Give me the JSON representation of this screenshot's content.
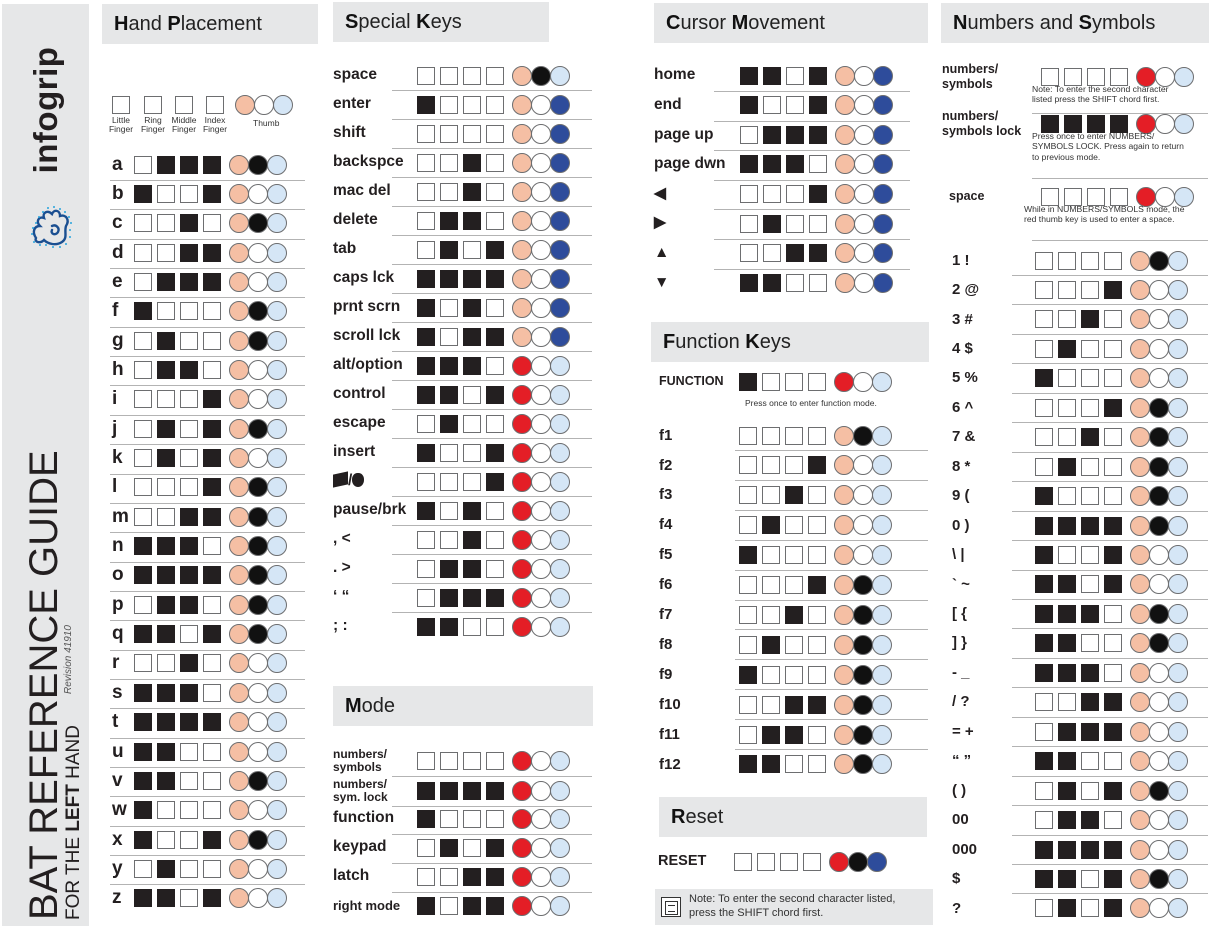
{
  "sidebar": {
    "brand": "infogrip",
    "title": "BAT REFERENCE GUIDE",
    "subtitle_prefix": "FOR THE ",
    "subtitle_bold": "LEFT",
    "subtitle_suffix": " HAND",
    "revision": "Revision 41910",
    "logo_icon": "hand-logo-icon"
  },
  "legend_encoding": {
    "fingers": "1 = key pressed (black square), 0 = not pressed",
    "thumbs": "p=peach, r=red, w=white, b=black, l=light-blue, u=dark-blue"
  },
  "colors": {
    "peach": "#f5bfa4",
    "red": "#e41e26",
    "black": "#111111",
    "light_blue": "#d5e6f6",
    "dark_blue": "#2e4c9b",
    "header_bg": "#e6e7e8"
  },
  "hand_placement": {
    "header_bold": "H",
    "header_rest": "and ",
    "header_bold2": "P",
    "header_rest2": "lacement",
    "legend": {
      "fingers": [
        "Little\nFinger",
        "Ring\nFinger",
        "Middle\nFinger",
        "Index\nFinger"
      ],
      "thumb": "Thumb"
    },
    "rows": [
      {
        "label": "a",
        "fingers": "0111",
        "thumbs": "pbl"
      },
      {
        "label": "b",
        "fingers": "1001",
        "thumbs": "pwl"
      },
      {
        "label": "c",
        "fingers": "0010",
        "thumbs": "pbl"
      },
      {
        "label": "d",
        "fingers": "0011",
        "thumbs": "pwl"
      },
      {
        "label": "e",
        "fingers": "0111",
        "thumbs": "pwl"
      },
      {
        "label": "f",
        "fingers": "1000",
        "thumbs": "pbl"
      },
      {
        "label": "g",
        "fingers": "0100",
        "thumbs": "pbl"
      },
      {
        "label": "h",
        "fingers": "0110",
        "thumbs": "pwl"
      },
      {
        "label": "i",
        "fingers": "0001",
        "thumbs": "pwl"
      },
      {
        "label": "j",
        "fingers": "0101",
        "thumbs": "pbl"
      },
      {
        "label": "k",
        "fingers": "0101",
        "thumbs": "pwl"
      },
      {
        "label": "l",
        "fingers": "0001",
        "thumbs": "pbl"
      },
      {
        "label": "m",
        "fingers": "0011",
        "thumbs": "pbl"
      },
      {
        "label": "n",
        "fingers": "1110",
        "thumbs": "pbl"
      },
      {
        "label": "o",
        "fingers": "1111",
        "thumbs": "pbl"
      },
      {
        "label": "p",
        "fingers": "0110",
        "thumbs": "pbl"
      },
      {
        "label": "q",
        "fingers": "1101",
        "thumbs": "pbl"
      },
      {
        "label": "r",
        "fingers": "0010",
        "thumbs": "pwl"
      },
      {
        "label": "s",
        "fingers": "1110",
        "thumbs": "pwl"
      },
      {
        "label": "t",
        "fingers": "1111",
        "thumbs": "pwl"
      },
      {
        "label": "u",
        "fingers": "1100",
        "thumbs": "pwl"
      },
      {
        "label": "v",
        "fingers": "1100",
        "thumbs": "pbl"
      },
      {
        "label": "w",
        "fingers": "1000",
        "thumbs": "pwl"
      },
      {
        "label": "x",
        "fingers": "1001",
        "thumbs": "pbl"
      },
      {
        "label": "y",
        "fingers": "0100",
        "thumbs": "pwl"
      },
      {
        "label": "z",
        "fingers": "1101",
        "thumbs": "pwl"
      }
    ]
  },
  "special_keys": {
    "header_bold": "S",
    "header_rest": "pecial ",
    "header_bold2": "K",
    "header_rest2": "eys",
    "rows": [
      {
        "label": "space",
        "fingers": "0000",
        "thumbs": "pbl"
      },
      {
        "label": "enter",
        "fingers": "1000",
        "thumbs": "pwu"
      },
      {
        "label": "shift",
        "fingers": "0000",
        "thumbs": "pwu"
      },
      {
        "label": "backspce",
        "fingers": "0010",
        "thumbs": "pwu"
      },
      {
        "label": "mac del",
        "fingers": "0010",
        "thumbs": "pwu"
      },
      {
        "label": "delete",
        "fingers": "0110",
        "thumbs": "pwu"
      },
      {
        "label": "tab",
        "fingers": "0101",
        "thumbs": "pwu"
      },
      {
        "label": "caps lck",
        "fingers": "1111",
        "thumbs": "pwu"
      },
      {
        "label": "prnt scrn",
        "fingers": "1010",
        "thumbs": "pwu"
      },
      {
        "label": "scroll lck",
        "fingers": "1011",
        "thumbs": "pwu"
      },
      {
        "label": "alt/option",
        "fingers": "1110",
        "thumbs": "rwl"
      },
      {
        "label": "control",
        "fingers": "1101",
        "thumbs": "rwl"
      },
      {
        "label": "escape",
        "fingers": "0100",
        "thumbs": "rwl"
      },
      {
        "label": "insert",
        "fingers": "1001",
        "thumbs": "rwl"
      },
      {
        "label": "⊞/",
        "fingers": "0001",
        "thumbs": "rwl"
      },
      {
        "label": "pause/brk",
        "fingers": "1010",
        "thumbs": "rwl"
      },
      {
        "label": ",  <",
        "fingers": "0010",
        "thumbs": "rwl"
      },
      {
        "label": ".  >",
        "fingers": "0110",
        "thumbs": "rwl"
      },
      {
        "label": "‘  “",
        "fingers": "0111",
        "thumbs": "rwl"
      },
      {
        "label": ";  :",
        "fingers": "1100",
        "thumbs": "rwl"
      }
    ]
  },
  "mode": {
    "header_bold": "M",
    "header_rest": "ode",
    "rows": [
      {
        "label": "numbers/\nsymbols",
        "fingers": "0000",
        "thumbs": "rwl",
        "small": true
      },
      {
        "label": "numbers/\nsym. lock",
        "fingers": "1111",
        "thumbs": "rwl",
        "small": true
      },
      {
        "label": "function",
        "fingers": "1000",
        "thumbs": "rwl"
      },
      {
        "label": "keypad",
        "fingers": "0101",
        "thumbs": "rwl"
      },
      {
        "label": "latch",
        "fingers": "0011",
        "thumbs": "rwl"
      },
      {
        "label": "right mode",
        "fingers": "1011",
        "thumbs": "rwl",
        "medium": true
      }
    ]
  },
  "cursor_movement": {
    "header_bold": "C",
    "header_rest": "ursor ",
    "header_bold2": "M",
    "header_rest2": "ovement",
    "rows": [
      {
        "label": "home",
        "fingers": "1101",
        "thumbs": "pwu"
      },
      {
        "label": "end",
        "fingers": "1001",
        "thumbs": "pwu"
      },
      {
        "label": "page up",
        "fingers": "0111",
        "thumbs": "pwu"
      },
      {
        "label": "page dwn",
        "fingers": "1110",
        "thumbs": "pwu"
      },
      {
        "label": "◀",
        "fingers": "0001",
        "thumbs": "pwu"
      },
      {
        "label": "▶",
        "fingers": "0100",
        "thumbs": "pwu"
      },
      {
        "label": "▲",
        "fingers": "0011",
        "thumbs": "pwu"
      },
      {
        "label": "▼",
        "fingers": "1100",
        "thumbs": "pwu"
      }
    ]
  },
  "function_keys": {
    "header_bold": "F",
    "header_rest": "unction ",
    "header_bold2": "K",
    "header_rest2": "eys",
    "function_row": {
      "label": "FUNCTION",
      "fingers": "1000",
      "thumbs": "rwl",
      "note": "Press once to enter function mode."
    },
    "rows": [
      {
        "label": "f1",
        "fingers": "0000",
        "thumbs": "pbl"
      },
      {
        "label": "f2",
        "fingers": "0001",
        "thumbs": "pwl"
      },
      {
        "label": "f3",
        "fingers": "0010",
        "thumbs": "pwl"
      },
      {
        "label": "f4",
        "fingers": "0100",
        "thumbs": "pwl"
      },
      {
        "label": "f5",
        "fingers": "1000",
        "thumbs": "pwl"
      },
      {
        "label": "f6",
        "fingers": "0001",
        "thumbs": "pbl"
      },
      {
        "label": "f7",
        "fingers": "0010",
        "thumbs": "pbl"
      },
      {
        "label": "f8",
        "fingers": "0100",
        "thumbs": "pbl"
      },
      {
        "label": "f9",
        "fingers": "1000",
        "thumbs": "pbl"
      },
      {
        "label": "f10",
        "fingers": "0011",
        "thumbs": "pbl"
      },
      {
        "label": "f11",
        "fingers": "0110",
        "thumbs": "pbl"
      },
      {
        "label": "f12",
        "fingers": "1100",
        "thumbs": "pbl"
      }
    ]
  },
  "reset": {
    "header_bold": "R",
    "header_rest": "eset",
    "row": {
      "label": "RESET",
      "fingers": "0000",
      "thumbs": "rbu"
    },
    "note": "Note: To enter the second character listed,\npress the SHIFT chord first.",
    "note_icon": "note-icon"
  },
  "numbers_symbols": {
    "header_bold": "N",
    "header_rest": "umbers and ",
    "header_bold2": "S",
    "header_rest2": "ymbols",
    "mode_rows": [
      {
        "label": "numbers/\nsymbols",
        "fingers": "0000",
        "thumbs": "rwl",
        "note": "Note: To enter the second character\nlisted press the SHIFT chord first."
      },
      {
        "label": "numbers/\nsymbols lock",
        "fingers": "1111",
        "thumbs": "rwl",
        "note": "Press once to enter NUMBERS/\nSYMBOLS LOCK. Press again to return\n to previous mode."
      },
      {
        "label": "space",
        "fingers": "0000",
        "thumbs": "rwl",
        "note": "While in NUMBERS/SYMBOLS mode, the\nred thumb key is used to enter a space."
      }
    ],
    "rows": [
      {
        "label": "1 !",
        "fingers": "0000",
        "thumbs": "pbl"
      },
      {
        "label": "2 @",
        "fingers": "0001",
        "thumbs": "pwl"
      },
      {
        "label": "3 #",
        "fingers": "0010",
        "thumbs": "pwl"
      },
      {
        "label": "4 $",
        "fingers": "0100",
        "thumbs": "pwl"
      },
      {
        "label": "5 %",
        "fingers": "1000",
        "thumbs": "pwl"
      },
      {
        "label": "6 ^",
        "fingers": "0001",
        "thumbs": "pbl"
      },
      {
        "label": "7 &",
        "fingers": "0010",
        "thumbs": "pbl"
      },
      {
        "label": "8 *",
        "fingers": "0100",
        "thumbs": "pbl"
      },
      {
        "label": "9 (",
        "fingers": "1000",
        "thumbs": "pbl"
      },
      {
        "label": "0 )",
        "fingers": "1111",
        "thumbs": "pbl"
      },
      {
        "label": "\\ |",
        "fingers": "1001",
        "thumbs": "pwl"
      },
      {
        "label": "` ~",
        "fingers": "1101",
        "thumbs": "pwl"
      },
      {
        "label": "[ {",
        "fingers": "1110",
        "thumbs": "pbl"
      },
      {
        "label": "] }",
        "fingers": "1100",
        "thumbs": "pbl"
      },
      {
        "label": "- _",
        "fingers": "1110",
        "thumbs": "pwl"
      },
      {
        "label": "/ ?",
        "fingers": "0011",
        "thumbs": "pwl"
      },
      {
        "label": "= +",
        "fingers": "0111",
        "thumbs": "pwl"
      },
      {
        "label": "“ ”",
        "fingers": "1100",
        "thumbs": "pwl"
      },
      {
        "label": "( )",
        "fingers": "0101",
        "thumbs": "pbl"
      },
      {
        "label": "00",
        "fingers": "0110",
        "thumbs": "pwl"
      },
      {
        "label": "000",
        "fingers": "1111",
        "thumbs": "pwl"
      },
      {
        "label": "$",
        "fingers": "1101",
        "thumbs": "pbl"
      },
      {
        "label": "?",
        "fingers": "0101",
        "thumbs": "pwl"
      }
    ]
  }
}
